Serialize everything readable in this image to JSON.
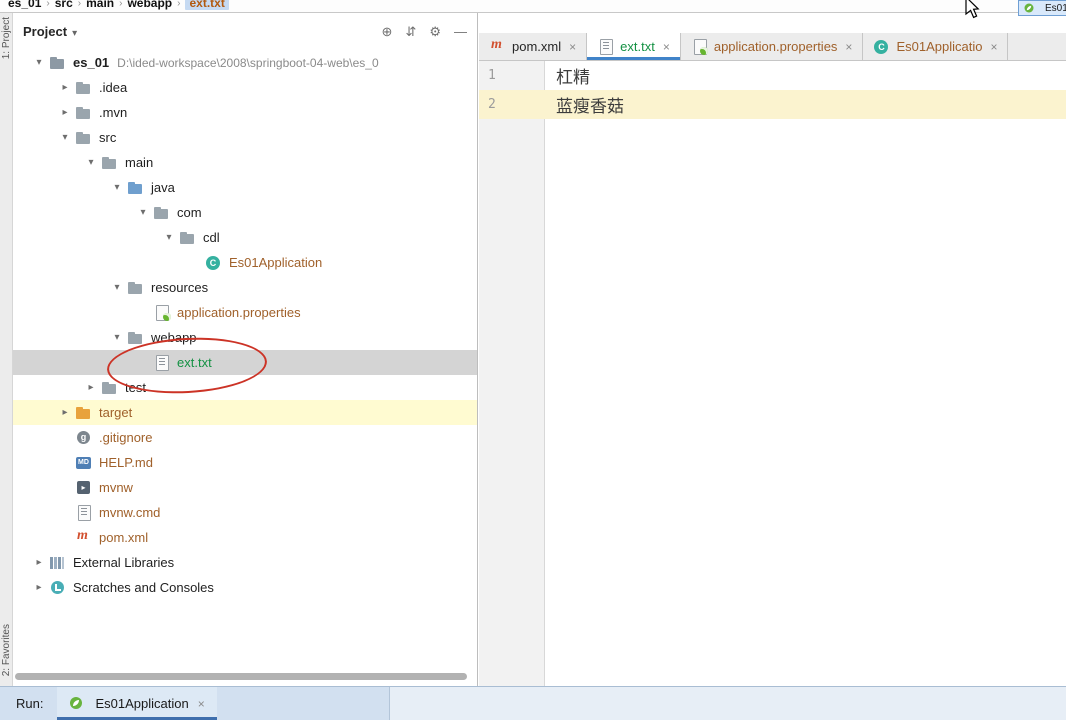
{
  "colors": {
    "green_file": "#149143",
    "brown_file": "#A0612B",
    "dark_text": "#262626",
    "path_gray": "#8A8A8A",
    "tab_underline": "#4083C9",
    "selected_row": "#D4D4D4",
    "target_row": "#FFFBD1",
    "caret_row": "#FBF3CF",
    "annotation_red": "#CC3326"
  },
  "breadcrumb": {
    "segments": [
      "es_01",
      "src",
      "main",
      "webapp",
      "ext.txt"
    ]
  },
  "top_right": {
    "run_config_label": "Es01"
  },
  "left_strip": {
    "top_label": "1: Project",
    "bottom_label": "2: Favorites"
  },
  "project_panel": {
    "title": "Project",
    "header_icons": [
      {
        "name": "locate-icon",
        "glyph": "⊕"
      },
      {
        "name": "collapse-all-icon",
        "glyph": "⇵"
      },
      {
        "name": "settings-gear-icon",
        "glyph": "⚙"
      },
      {
        "name": "hide-panel-icon",
        "glyph": "—"
      }
    ],
    "tree": [
      {
        "level": 0,
        "chevron": "down",
        "icon": "project-folder-icon",
        "label": "es_01",
        "bold": true,
        "path": "D:\\ided-workspace\\2008\\springboot-04-web\\es_0"
      },
      {
        "level": 1,
        "chevron": "right",
        "icon": "folder-icon",
        "label": ".idea"
      },
      {
        "level": 1,
        "chevron": "right",
        "icon": "folder-icon",
        "label": ".mvn"
      },
      {
        "level": 1,
        "chevron": "down",
        "icon": "folder-icon",
        "label": "src"
      },
      {
        "level": 2,
        "chevron": "down",
        "icon": "folder-icon",
        "label": "main"
      },
      {
        "level": 3,
        "chevron": "down",
        "icon": "sources-folder-icon",
        "label": "java"
      },
      {
        "level": 4,
        "chevron": "down",
        "icon": "folder-icon",
        "label": "com"
      },
      {
        "level": 5,
        "chevron": "down",
        "icon": "folder-icon",
        "label": "cdl"
      },
      {
        "level": 6,
        "chevron": "none",
        "icon": "spring-class-icon",
        "label": "Es01Application",
        "color": "brown_file"
      },
      {
        "level": 3,
        "chevron": "down",
        "icon": "resources-folder-icon",
        "label": "resources"
      },
      {
        "level": 4,
        "chevron": "none",
        "icon": "spring-properties-icon",
        "label": "application.properties",
        "color": "brown_file"
      },
      {
        "level": 3,
        "chevron": "down",
        "icon": "folder-icon",
        "label": "webapp"
      },
      {
        "level": 4,
        "chevron": "none",
        "icon": "text-file-icon",
        "label": "ext.txt",
        "color": "green_file",
        "selected": true
      },
      {
        "level": 2,
        "chevron": "right",
        "icon": "folder-icon",
        "label": "test"
      },
      {
        "level": 1,
        "chevron": "right",
        "icon": "excluded-folder-icon",
        "label": "target",
        "color": "brown_file",
        "row_highlight": "yellow"
      },
      {
        "level": 1,
        "chevron": "none",
        "icon": "gitignore-icon",
        "label": ".gitignore",
        "color": "brown_file"
      },
      {
        "level": 1,
        "chevron": "none",
        "icon": "markdown-icon",
        "label": "HELP.md",
        "color": "brown_file"
      },
      {
        "level": 1,
        "chevron": "none",
        "icon": "shell-icon",
        "label": "mvnw",
        "color": "brown_file"
      },
      {
        "level": 1,
        "chevron": "none",
        "icon": "text-file-icon",
        "label": "mvnw.cmd",
        "color": "brown_file"
      },
      {
        "level": 1,
        "chevron": "none",
        "icon": "maven-icon",
        "label": "pom.xml",
        "color": "brown_file"
      },
      {
        "level": 0,
        "chevron": "right",
        "icon": "libraries-icon",
        "label": "External Libraries"
      },
      {
        "level": 0,
        "chevron": "right",
        "icon": "scratches-icon",
        "label": "Scratches and Consoles"
      }
    ]
  },
  "editor": {
    "tabs": [
      {
        "label": "pom.xml",
        "icon": "maven-icon",
        "color": "dark_text",
        "selected": false
      },
      {
        "label": "ext.txt",
        "icon": "text-file-icon",
        "color": "green_file",
        "selected": true
      },
      {
        "label": "application.properties",
        "icon": "spring-properties-icon",
        "color": "brown_file",
        "selected": false
      },
      {
        "label": "Es01Applicatio",
        "icon": "spring-class-icon",
        "color": "brown_file",
        "selected": false
      }
    ],
    "lines": [
      {
        "number": "1",
        "text": "杠精",
        "current": false
      },
      {
        "number": "2",
        "text": "蓝瘦香菇",
        "current": true
      }
    ]
  },
  "run_panel": {
    "label": "Run:",
    "tab_label": "Es01Application"
  }
}
